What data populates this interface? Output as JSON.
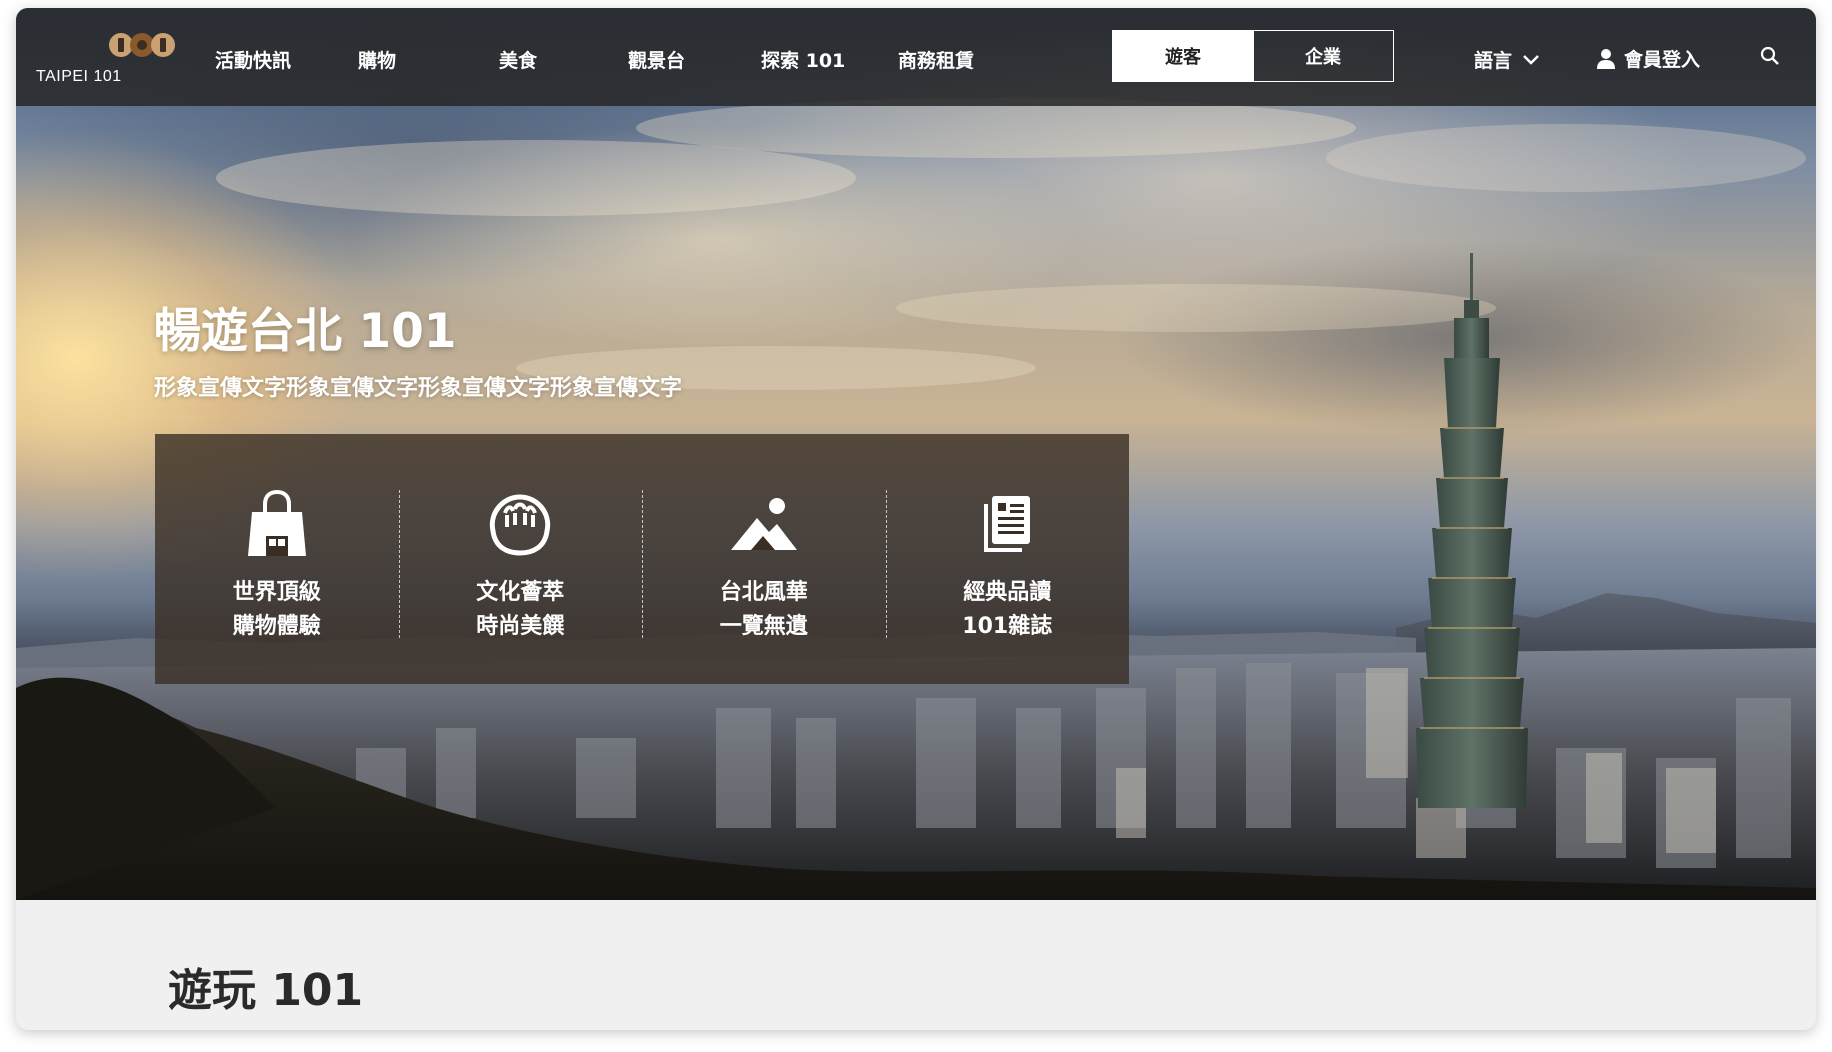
{
  "brand": {
    "logo_text": "TAIPEI 101",
    "logo_colors": [
      "#c9a173",
      "#8a5a2c"
    ]
  },
  "nav": {
    "items": [
      {
        "label": "活動快訊"
      },
      {
        "label": "購物"
      },
      {
        "label": "美食"
      },
      {
        "label": "觀景台"
      },
      {
        "label": "探索 101"
      },
      {
        "label": "商務租賃"
      }
    ],
    "audience_toggle": {
      "visitor": "遊客",
      "business": "企業",
      "selected": "遊客"
    },
    "language_label": "語言",
    "login_label": "會員登入",
    "icons": {
      "language": "chevron-down-icon",
      "login": "user-icon",
      "search": "search-icon"
    }
  },
  "hero": {
    "title": "暢遊台北 101",
    "subtitle": "形象宣傳文字形象宣傳文字形象宣傳文字形象宣傳文字",
    "features": [
      {
        "icon": "shopping-bag-icon",
        "line1": "世界頂級",
        "line2": "購物體驗"
      },
      {
        "icon": "dumpling-icon",
        "line1": "文化薈萃",
        "line2": "時尚美饌"
      },
      {
        "icon": "mountain-icon",
        "line1": "台北風華",
        "line2": "一覽無遺"
      },
      {
        "icon": "magazine-icon",
        "line1": "經典品讀",
        "line2": "101雜誌"
      }
    ]
  },
  "section": {
    "title": "遊玩 101"
  },
  "colors": {
    "nav_bg": "#262626",
    "panel_bg": "#3a2e24",
    "page_bg": "#f0f0f0",
    "text_light": "#ffffff"
  }
}
